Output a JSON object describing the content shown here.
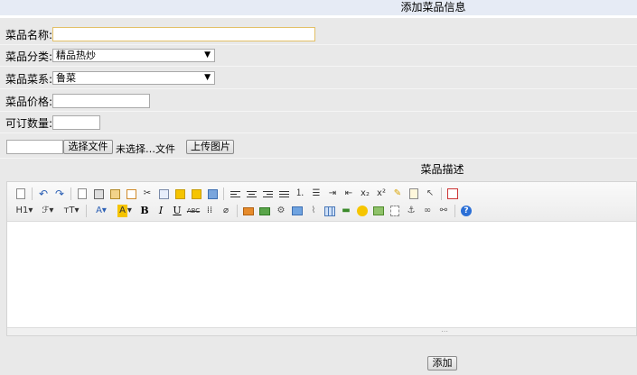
{
  "page": {
    "title": "添加菜品信息"
  },
  "form": {
    "name": {
      "label": "菜品名称:",
      "value": ""
    },
    "category": {
      "label": "菜品分类:",
      "value": "精品热炒"
    },
    "cuisine": {
      "label": "菜品菜系:",
      "value": "鲁菜"
    },
    "price": {
      "label": "菜品价格:",
      "value": ""
    },
    "quantity": {
      "label": "可订数量:",
      "value": ""
    },
    "file": {
      "path_value": "",
      "choose_label": "选择文件",
      "status": "未选择…文件",
      "upload_label": "上传图片"
    }
  },
  "description": {
    "title": "菜品描述"
  },
  "editor": {
    "toolbar_row1": [
      "source-icon",
      "undo-icon",
      "redo-icon",
      "preview-icon",
      "print-icon",
      "template-icon",
      "code-icon",
      "cut-icon",
      "copy-icon",
      "paste-icon",
      "paste-text-icon",
      "paste-word-icon",
      "align-left-icon",
      "align-center-icon",
      "align-right-icon",
      "justify-icon",
      "ordered-list-icon",
      "unordered-list-icon",
      "indent-icon",
      "outdent-icon",
      "subscript-icon",
      "superscript-icon",
      "clear-format-icon",
      "select-all-icon",
      "cursor-icon",
      "fullscreen-icon"
    ],
    "toolbar_row2": [
      "heading-icon",
      "font-family-icon",
      "font-size-icon",
      "font-color-icon",
      "highlight-color-icon",
      "bold-icon",
      "italic-icon",
      "underline-icon",
      "strikethrough-icon",
      "line-height-icon",
      "eraser-icon",
      "image-icon",
      "multi-image-icon",
      "flash-icon",
      "media-icon",
      "attachment-icon",
      "table-icon",
      "hr-icon",
      "emoticon-icon",
      "baidu-map-icon",
      "page-break-icon",
      "anchor-icon",
      "link-icon",
      "unlink-icon",
      "about-icon"
    ],
    "font_color_label": "A",
    "highlight_label": "A",
    "heading_label": "H1",
    "font_family_label": "ℱ",
    "font_size_label": "тT",
    "bold_label": "B",
    "italic_label": "I",
    "underline_label": "U",
    "strike_label": "ABC",
    "sub_label": "x₂",
    "sup_label": "x²",
    "content": ""
  },
  "actions": {
    "submit_label": "添加"
  }
}
